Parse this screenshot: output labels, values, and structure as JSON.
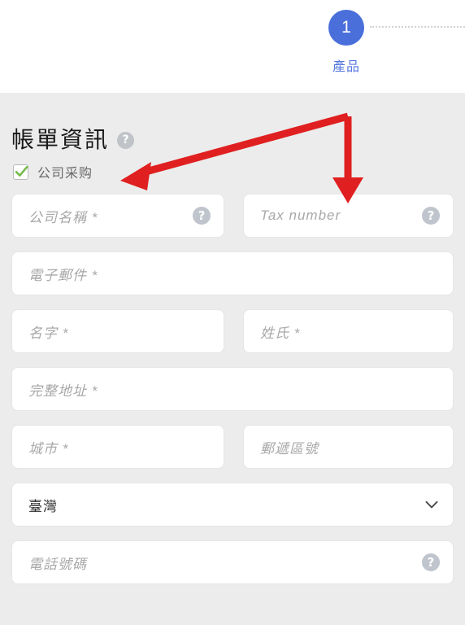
{
  "stepper": {
    "step_number": "1",
    "step_label": "產品",
    "connector": "dotted-line",
    "active_color": "#4a6fdb",
    "label_color": "#5577dd"
  },
  "billing": {
    "section_title": "帳單資訊",
    "section_help_icon": "question-mark-icon",
    "company_purchase_checkbox": {
      "label": "公司采购",
      "checked": true,
      "check_color": "#76bb4a"
    }
  },
  "fields": {
    "company_name": {
      "placeholder": "公司名稱 *",
      "value": "",
      "help_icon": "question-mark-icon"
    },
    "tax_number": {
      "placeholder": "Tax number",
      "value": "",
      "help_icon": "question-mark-icon"
    },
    "email": {
      "placeholder": "電子郵件 *",
      "value": ""
    },
    "first_name": {
      "placeholder": "名字 *",
      "value": ""
    },
    "last_name": {
      "placeholder": "姓氏 *",
      "value": ""
    },
    "address": {
      "placeholder": "完整地址 *",
      "value": ""
    },
    "city": {
      "placeholder": "城市 *",
      "value": ""
    },
    "postal_code": {
      "placeholder": "郵遞區號",
      "value": ""
    },
    "country": {
      "selected": "臺灣",
      "chevron_icon": "chevron-down-icon"
    },
    "phone": {
      "placeholder": "電話號碼",
      "value": "",
      "help_icon": "question-mark-icon"
    }
  },
  "annotations": {
    "color": "#e02020",
    "arrow_to_checkbox": "arrow pointing left-down to 公司采购 checkbox",
    "arrow_to_tax_number": "arrow pointing down to Tax number field"
  }
}
